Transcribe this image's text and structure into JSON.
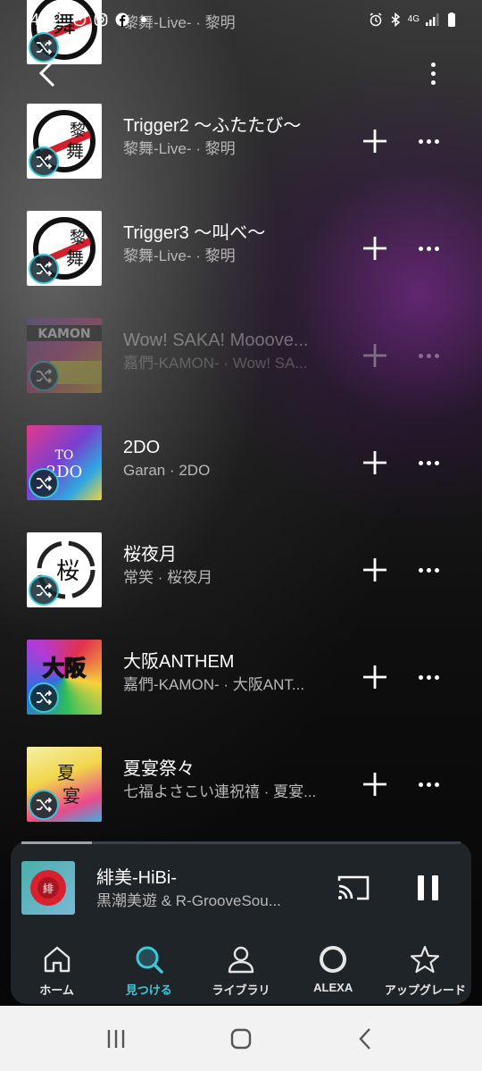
{
  "status_bar": {
    "time": "4:52",
    "network_label": "4G",
    "icons": [
      "messenger-icon",
      "instagram-icon",
      "facebook-icon",
      "dot-icon",
      "alarm-icon",
      "bluetooth-icon",
      "signal-icon",
      "battery-icon"
    ]
  },
  "header": {
    "back_icon": "chevron-left-icon",
    "more_icon": "more-vertical-icon"
  },
  "tracks": [
    {
      "title": "",
      "subtitle": "黎舞-Live- · 黎明",
      "art_theme": "reibu-white",
      "dimmed": false
    },
    {
      "title": "Trigger2 〜ふたたび〜",
      "subtitle": "黎舞-Live- · 黎明",
      "art_theme": "reibu-white",
      "dimmed": false
    },
    {
      "title": "Trigger3 〜叫べ〜",
      "subtitle": "黎舞-Live- · 黎明",
      "art_theme": "reibu-white",
      "dimmed": false
    },
    {
      "title": "Wow! SAKA! Mooove...",
      "subtitle": "嘉們-KAMON- · Wow! SA...",
      "art_theme": "kamon-colorful",
      "dimmed": true
    },
    {
      "title": "2DO",
      "subtitle": "Garan · 2DO",
      "art_theme": "2do-colorful",
      "dimmed": false
    },
    {
      "title": "桜夜月",
      "subtitle": "常笑 · 桜夜月",
      "art_theme": "ink-white",
      "dimmed": false
    },
    {
      "title": "大阪ANTHEM",
      "subtitle": "嘉們-KAMON- · 大阪ANT...",
      "art_theme": "osaka-neon",
      "dimmed": false
    },
    {
      "title": "夏宴祭々",
      "subtitle": "七福よさこい連祝禧 · 夏宴...",
      "art_theme": "natsu-yellow",
      "dimmed": false
    }
  ],
  "now_playing": {
    "title": "緋美-HiBi-",
    "artist": "黒潮美遊 & R-GrooveSou...",
    "progress": 0.16
  },
  "bottom_nav": [
    {
      "label": "ホーム",
      "icon": "home-icon",
      "active": false
    },
    {
      "label": "見つける",
      "icon": "search-icon",
      "active": true
    },
    {
      "label": "ライブラリ",
      "icon": "library-person-icon",
      "active": false
    },
    {
      "label": "ALEXA",
      "icon": "alexa-ring-icon",
      "active": false
    },
    {
      "label": "アップグレード",
      "icon": "star-icon",
      "active": false
    }
  ],
  "colors": {
    "accent": "#3cc8da",
    "panel": "#1f2428"
  }
}
